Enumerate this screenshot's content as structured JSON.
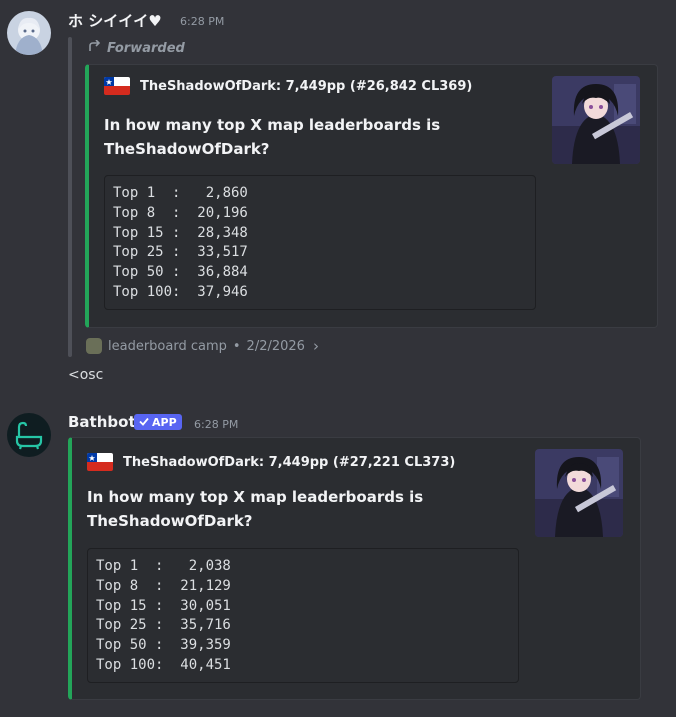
{
  "message1": {
    "username": "ホ シイイイ♥",
    "time": "6:28 PM",
    "forwarded_label": "Forwarded",
    "embed": {
      "author": "TheShadowOfDark: 7,449pp (#26,842 CL369)",
      "title": "In how many top X map leaderboards is TheShadowOfDark?",
      "code_lines": [
        "Top 1  :   2,860",
        "Top 8  :  20,196",
        "Top 15 :  28,348",
        "Top 25 :  33,517",
        "Top 50 :  36,884",
        "Top 100:  37,946"
      ]
    },
    "source": {
      "server": "leaderboard camp",
      "separator": "•",
      "date": "2/2/2026",
      "chevron": "›"
    },
    "text": "<osc"
  },
  "message2": {
    "username": "Bathbot",
    "badge": "APP",
    "time": "6:28 PM",
    "embed": {
      "author": "TheShadowOfDark: 7,449pp (#27,221 CL373)",
      "title": "In how many top X map leaderboards is TheShadowOfDark?",
      "code_lines": [
        "Top 1  :   2,038",
        "Top 8  :  21,129",
        "Top 15 :  30,051",
        "Top 25 :  35,716",
        "Top 50 :  39,359",
        "Top 100:  40,451"
      ]
    }
  },
  "colors": {
    "background": "#323339",
    "embed_bg": "#2b2d31",
    "embed_accent": "#23a559",
    "app_badge": "#5865f2",
    "muted": "#949ba4"
  },
  "icons": {
    "forward": "forward-arrow-icon",
    "flag": "chile-flag-icon",
    "chevron": "chevron-right-icon",
    "verified": "checkmark-icon",
    "bathbot": "bathtub-icon"
  }
}
